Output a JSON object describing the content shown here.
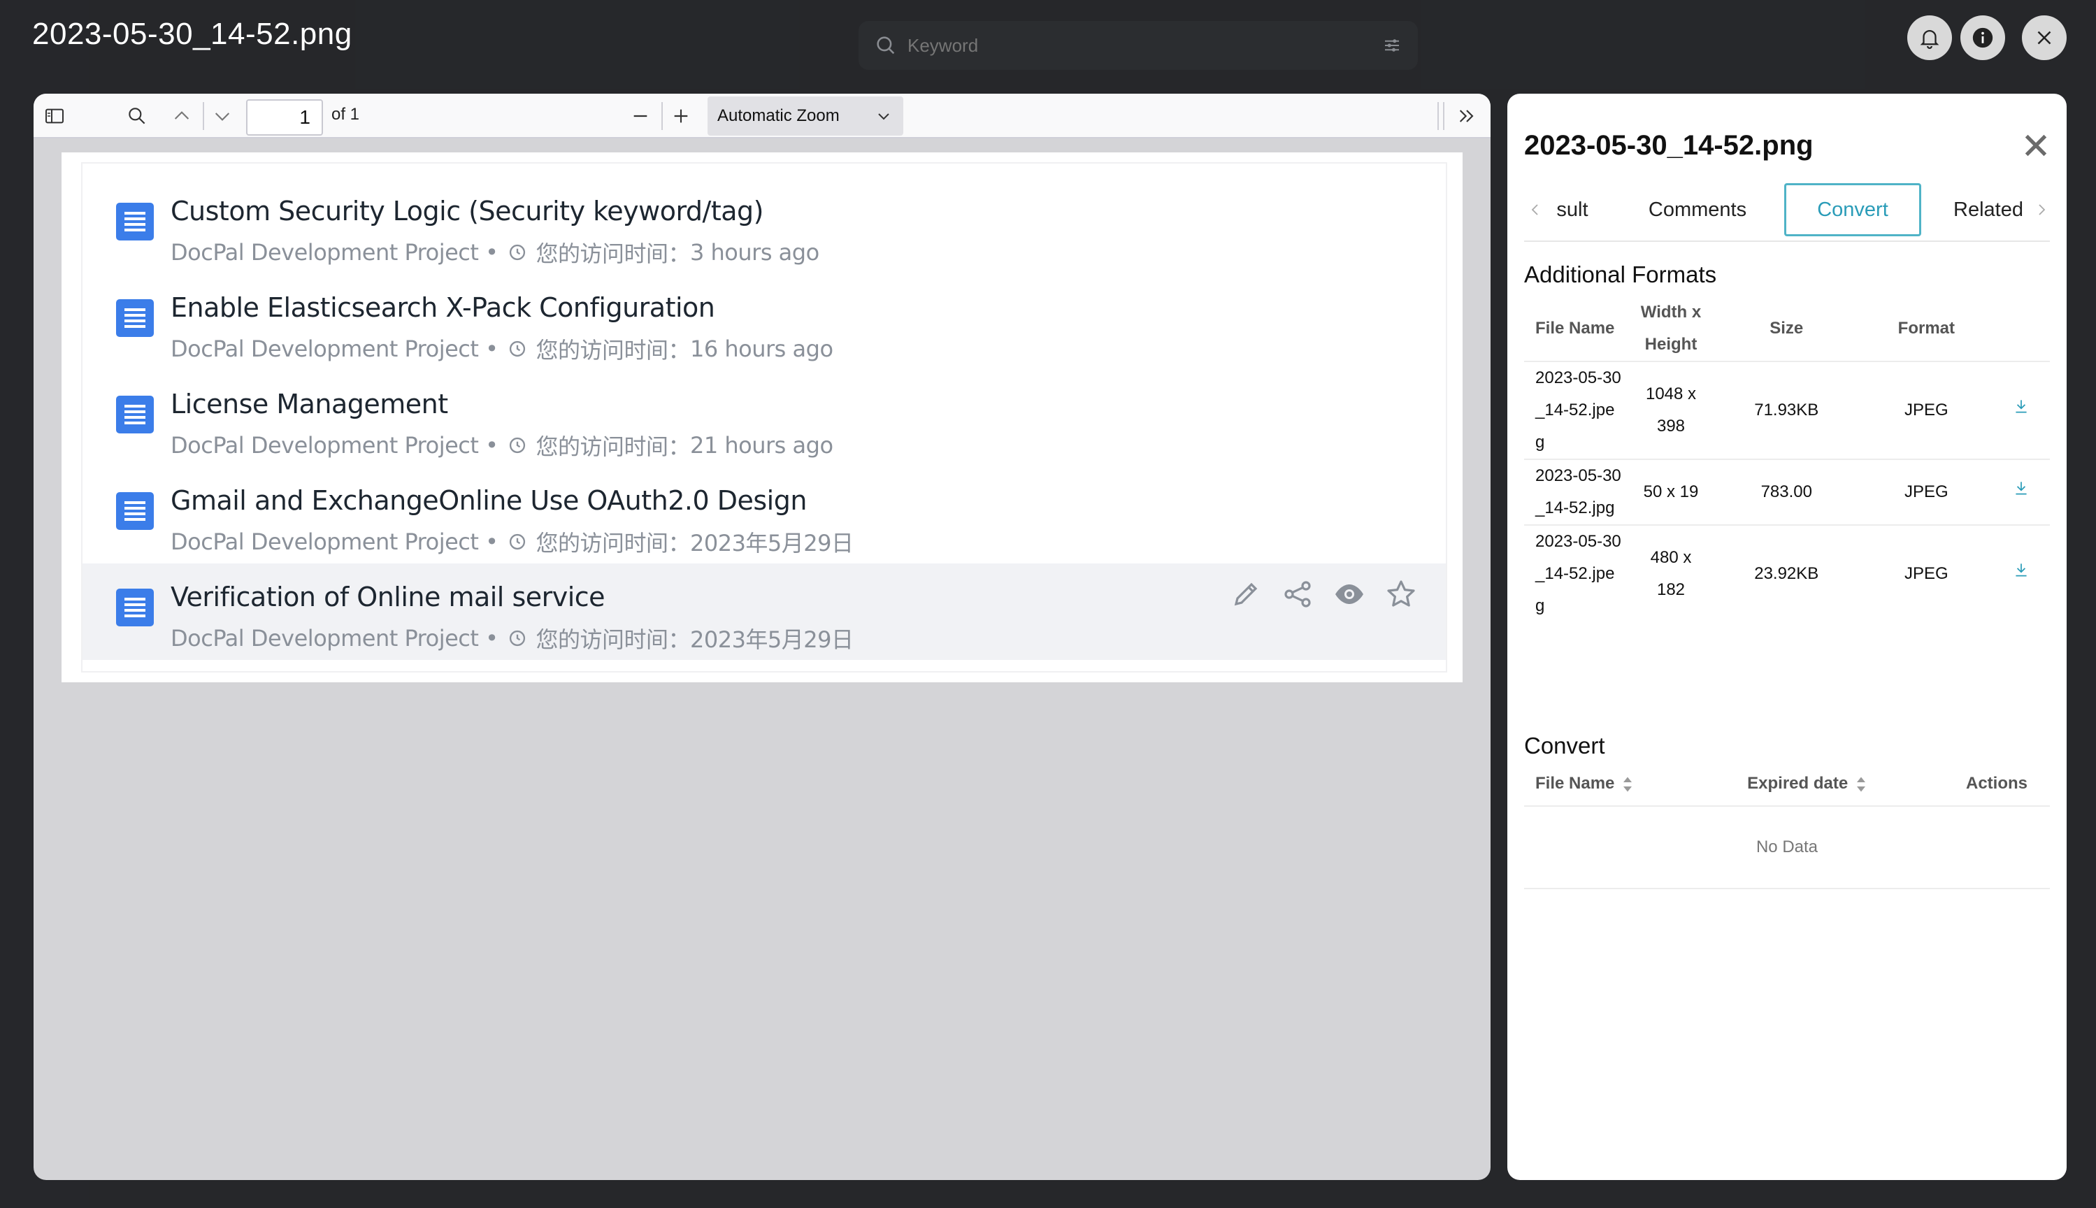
{
  "window": {
    "title": "2023-05-30_14-52.png",
    "search_placeholder": "Keyword"
  },
  "pdf_toolbar": {
    "page_value": "1",
    "page_of": "of 1",
    "zoom": "Automatic Zoom"
  },
  "document": {
    "items": [
      {
        "title": "Custom Security Logic (Security keyword/tag)",
        "project": "DocPal Development Project",
        "bullet": "•",
        "visit_label": "您的访问时间：",
        "visit_time": "3 hours ago"
      },
      {
        "title": "Enable Elasticsearch X-Pack Configuration",
        "project": "DocPal Development Project",
        "bullet": "•",
        "visit_label": "您的访问时间：",
        "visit_time": "16 hours ago"
      },
      {
        "title": "License Management",
        "project": "DocPal Development Project",
        "bullet": "•",
        "visit_label": "您的访问时间：",
        "visit_time": "21 hours ago"
      },
      {
        "title": "Gmail and ExchangeOnline Use OAuth2.0 Design",
        "project": "DocPal Development Project",
        "bullet": "•",
        "visit_label": "您的访问时间：",
        "visit_time": "2023年5月29日"
      },
      {
        "title": "Verification of Online mail service",
        "project": "DocPal Development Project",
        "bullet": "•",
        "visit_label": "您的访问时间：",
        "visit_time": "2023年5月29日"
      }
    ]
  },
  "panel": {
    "title": "2023-05-30_14-52.png",
    "tabs": [
      "sult",
      "Comments",
      "Convert",
      "Related"
    ],
    "active_tab": "Convert",
    "additional_formats": {
      "heading": "Additional Formats",
      "columns": [
        "File Name",
        "Width x Height",
        "Size",
        "Format"
      ],
      "rows": [
        {
          "name": "2023-05-30_14-52.jpeg",
          "dims": "1048 x 398",
          "size": "71.93KB",
          "format": "JPEG"
        },
        {
          "name": "2023-05-30_14-52.jpg",
          "dims": "50 x 19",
          "size": "783.00",
          "format": "JPEG"
        },
        {
          "name": "2023-05-30_14-52.jpeg",
          "dims": "480 x 182",
          "size": "23.92KB",
          "format": "JPEG"
        }
      ]
    },
    "convert": {
      "heading": "Convert",
      "columns": [
        "File Name",
        "Expired date",
        "Actions"
      ],
      "empty_text": "No Data"
    }
  },
  "colors": {
    "accent": "#2a9cb8",
    "doc_icon": "#3b7de9",
    "background": "#26282b"
  },
  "icons": [
    "search-icon",
    "filter-icon",
    "bell-icon",
    "info-icon",
    "close-icon",
    "sidebar-toggle-icon",
    "chevron-up-icon",
    "chevron-down-icon",
    "minus-icon",
    "plus-icon",
    "double-chevron-right-icon",
    "document-icon",
    "clock-icon",
    "pencil-icon",
    "share-icon",
    "eye-icon",
    "star-icon",
    "download-icon",
    "sort-icon"
  ]
}
